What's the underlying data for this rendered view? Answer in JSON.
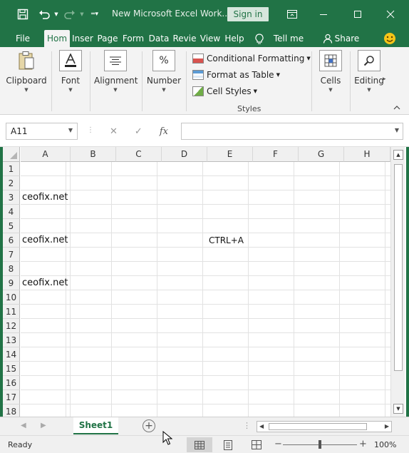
{
  "app": {
    "title": "New Microsoft Excel Work...",
    "sign_in": "Sign in"
  },
  "icons": {
    "save": "save-icon",
    "undo": "undo-icon",
    "redo": "redo-icon",
    "customize": "customize-qat-icon",
    "ribbon_display": "ribbon-display-icon",
    "minimize": "minimize-icon",
    "maximize": "maximize-icon",
    "close": "close-icon",
    "smiley": "smiley-icon",
    "share": "share-person-icon",
    "lightbulb": "lightbulb-icon"
  },
  "tabs": [
    {
      "label": "File"
    },
    {
      "label": "Hom"
    },
    {
      "label": "Inser"
    },
    {
      "label": "Page"
    },
    {
      "label": "Form"
    },
    {
      "label": "Data"
    },
    {
      "label": "Revie"
    },
    {
      "label": "View"
    },
    {
      "label": "Help"
    }
  ],
  "tell_me": "Tell me",
  "share": "Share",
  "ribbon": {
    "clipboard": "Clipboard",
    "font": "Font",
    "alignment": "Alignment",
    "number": "Number",
    "number_icon": "%",
    "conditional_formatting": "Conditional Formatting",
    "format_as_table": "Format as Table",
    "cell_styles": "Cell Styles",
    "styles": "Styles",
    "cells": "Cells",
    "editing": "Editing"
  },
  "formula_bar": {
    "name_box": "A11",
    "fx": "fx",
    "value": ""
  },
  "columns": [
    "A",
    "B",
    "C",
    "D",
    "E",
    "F",
    "G",
    "H"
  ],
  "rows": [
    "1",
    "2",
    "3",
    "4",
    "5",
    "6",
    "7",
    "8",
    "9",
    "10",
    "11",
    "12",
    "13",
    "14",
    "15",
    "16",
    "17",
    "18"
  ],
  "cells": {
    "A3": "ceofix.net",
    "A6": "ceofix.net",
    "E6": "CTRL+A",
    "A9": "ceofix.net"
  },
  "sheet": {
    "name": "Sheet1"
  },
  "status": {
    "text": "Ready",
    "zoom": "100%"
  },
  "colors": {
    "brand": "#217346"
  }
}
